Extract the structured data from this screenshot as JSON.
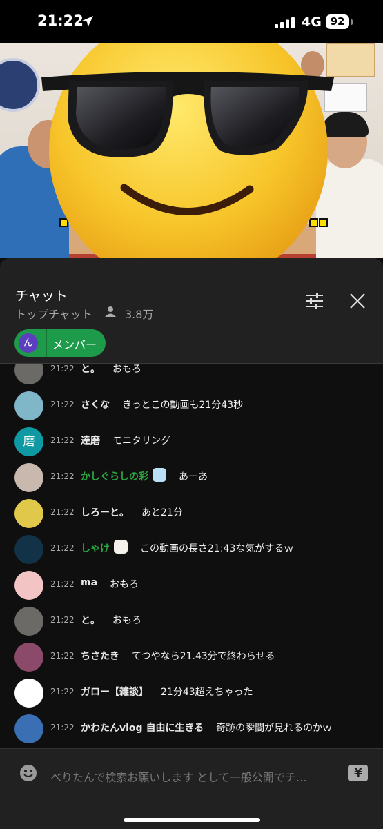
{
  "status_bar": {
    "time": "21:22",
    "network": "4G",
    "battery": "92"
  },
  "chat": {
    "title": "チャット",
    "mode": "トップチャット",
    "viewers": "3.8万",
    "member_chip": {
      "avatar_initial": "ん",
      "label": "メンバー"
    }
  },
  "messages": [
    {
      "time": "21:22",
      "author": "と。",
      "text": "おもろ",
      "avatar": "#6b6a66",
      "green": false
    },
    {
      "time": "21:22",
      "author": "さくな",
      "text": "きっとこの動画も21分43秒",
      "avatar": "#7fb7c9",
      "green": false
    },
    {
      "time": "21:22",
      "author": "達磨",
      "text": "モニタリング",
      "avatar": "#0f9aa3",
      "initial": "磨",
      "green": false
    },
    {
      "time": "21:22",
      "author": "かしぐらしの彩",
      "text": "あーあ",
      "avatar": "#c9b8ad",
      "green": true,
      "badge": "#b8dff5"
    },
    {
      "time": "21:22",
      "author": "しろーと。",
      "text": "あと21分",
      "avatar": "#e0c94a",
      "green": false
    },
    {
      "time": "21:22",
      "author": "しゃけ",
      "text": "この動画の長さ21:43な気がするｗ",
      "avatar": "#123247",
      "green": true,
      "badge": "#f4f0ea"
    },
    {
      "time": "21:22",
      "author": "ma",
      "text": "おもろ",
      "avatar": "#f2c4c4",
      "green": false
    },
    {
      "time": "21:22",
      "author": "と。",
      "text": "おもろ",
      "avatar": "#6b6a66",
      "green": false
    },
    {
      "time": "21:22",
      "author": "ちさたき",
      "text": "てつやなら21.43分で終わらせる",
      "avatar": "#8b4a6a",
      "green": false
    },
    {
      "time": "21:22",
      "author": "ガロー【雑談】",
      "text": "21分43超えちゃった",
      "avatar": "#ffffff",
      "green": false
    },
    {
      "time": "21:22",
      "author": "かわたんvlog 自由に生きる",
      "text": "奇跡の瞬間が見れるのかｗ",
      "avatar": "#3a6fb3",
      "green": false
    }
  ],
  "input": {
    "placeholder": "べりたんで検索お願いします として一般公開でチ…",
    "yen": "¥"
  }
}
